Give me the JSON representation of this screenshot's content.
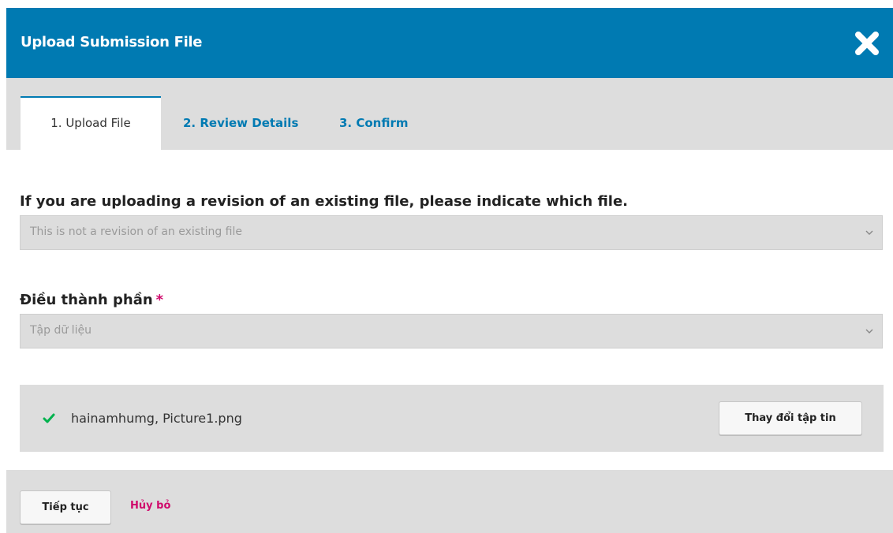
{
  "dialog": {
    "title": "Upload Submission File",
    "close_icon": "close-x-icon"
  },
  "tabs": [
    {
      "label": "1. Upload File",
      "active": true
    },
    {
      "label": "2. Review Details",
      "active": false
    },
    {
      "label": "3. Confirm",
      "active": false
    }
  ],
  "revision_field": {
    "label": "If you are uploading a revision of an existing file, please indicate which file.",
    "selected": "This is not a revision of an existing file",
    "icon": "chevron-down-icon"
  },
  "component_field": {
    "label": "Điều thành phần",
    "required_mark": "*",
    "selected": "Tập dữ liệu",
    "icon": "chevron-down-icon"
  },
  "uploaded_file": {
    "status_icon": "check-icon",
    "name": "hainamhumg, Picture1.png",
    "change_button": "Thay đổi tập tin"
  },
  "footer": {
    "continue_button": "Tiếp tục",
    "cancel_link": "Hủy bỏ"
  },
  "colors": {
    "header_bg": "#007ab2",
    "accent": "#007ab2",
    "required": "#d00a6c",
    "success": "#00b24e",
    "panel_bg": "#dddddd"
  }
}
